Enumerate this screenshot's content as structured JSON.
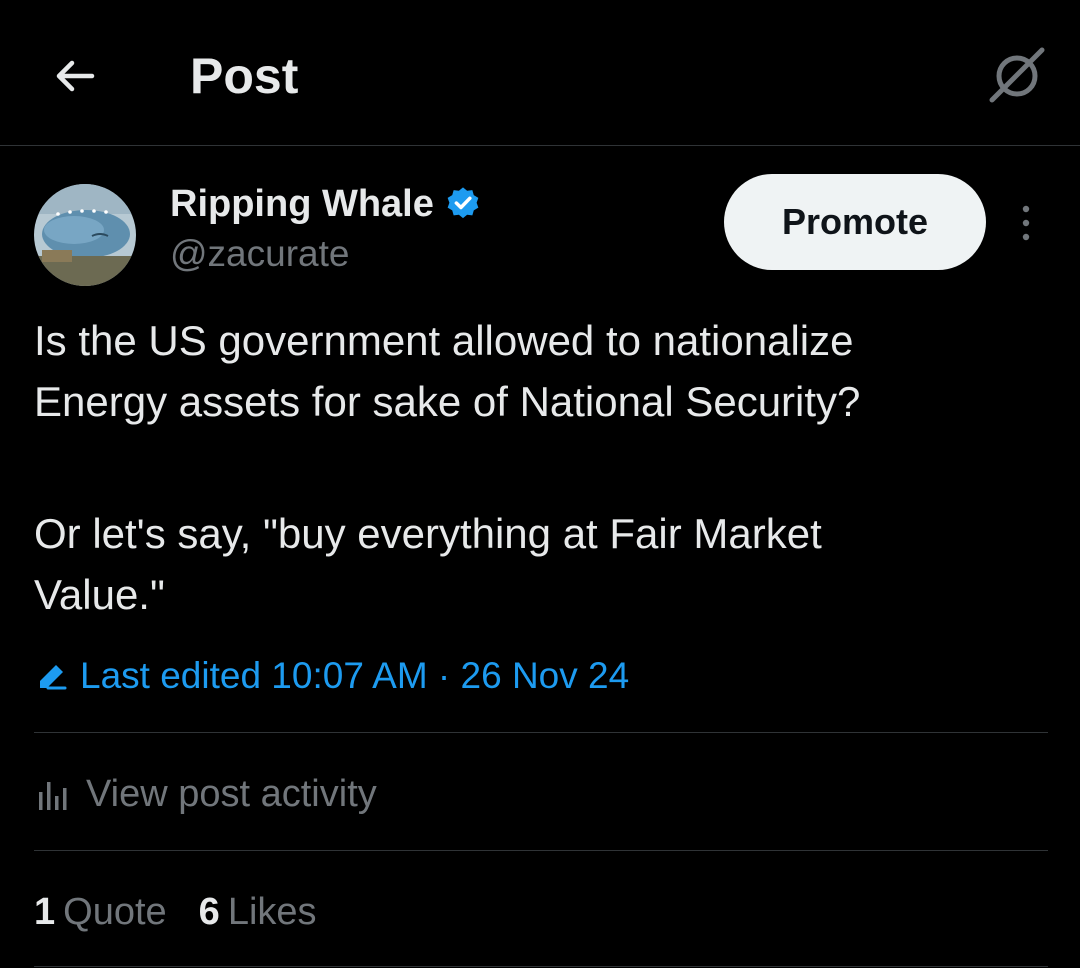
{
  "header": {
    "title": "Post",
    "back_icon": "arrow-left-icon",
    "grok_icon": "grok-icon"
  },
  "author": {
    "name": "Ripping Whale",
    "handle": "@zacurate",
    "verified": true,
    "verified_color": "#1d9bf0"
  },
  "actions": {
    "promote_label": "Promote",
    "more_icon": "more-vertical-icon"
  },
  "post": {
    "paragraph_1": "Is the US government allowed to nationalize\nEnergy assets for sake of National Security?",
    "paragraph_2": "Or let's say, \"buy everything at Fair Market\nValue.\"",
    "edited_text": "Last edited 10:07 AM · 26 Nov 24",
    "edited_icon": "pencil-icon"
  },
  "activity": {
    "label": "View post activity",
    "icon": "bar-chart-icon"
  },
  "stats": {
    "quotes_count": "1",
    "quotes_label": "Quote",
    "likes_count": "6",
    "likes_label": "Likes"
  },
  "colors": {
    "background": "#000000",
    "text_primary": "#e7e9ea",
    "text_secondary": "#71767b",
    "accent": "#1d9bf0",
    "divider": "#2f3336"
  }
}
